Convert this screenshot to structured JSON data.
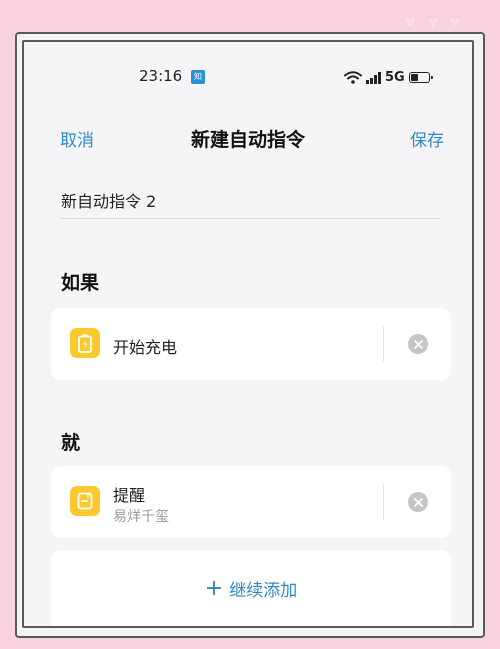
{
  "status_bar": {
    "time": "23:16",
    "badge_text": "知",
    "network": "5G",
    "battery_level": 0.45
  },
  "nav": {
    "cancel_label": "取消",
    "title": "新建自动指令",
    "save_label": "保存"
  },
  "automation_name": {
    "value": "新自动指令 2"
  },
  "if_section": {
    "label": "如果",
    "trigger": {
      "title": "开始充电",
      "icon": "battery-charging-icon"
    }
  },
  "then_section": {
    "label": "就",
    "action": {
      "title": "提醒",
      "subtitle": "易烊千玺",
      "icon": "reminder-icon"
    }
  },
  "add_more": {
    "label": "继续添加",
    "icon": "plus-icon"
  },
  "colors": {
    "accent": "#2f88c5",
    "icon_yellow": "#fbc92e",
    "background_pink": "#f9d2e0",
    "card_bg": "#ffffff",
    "screen_bg": "#f5f5f7"
  }
}
